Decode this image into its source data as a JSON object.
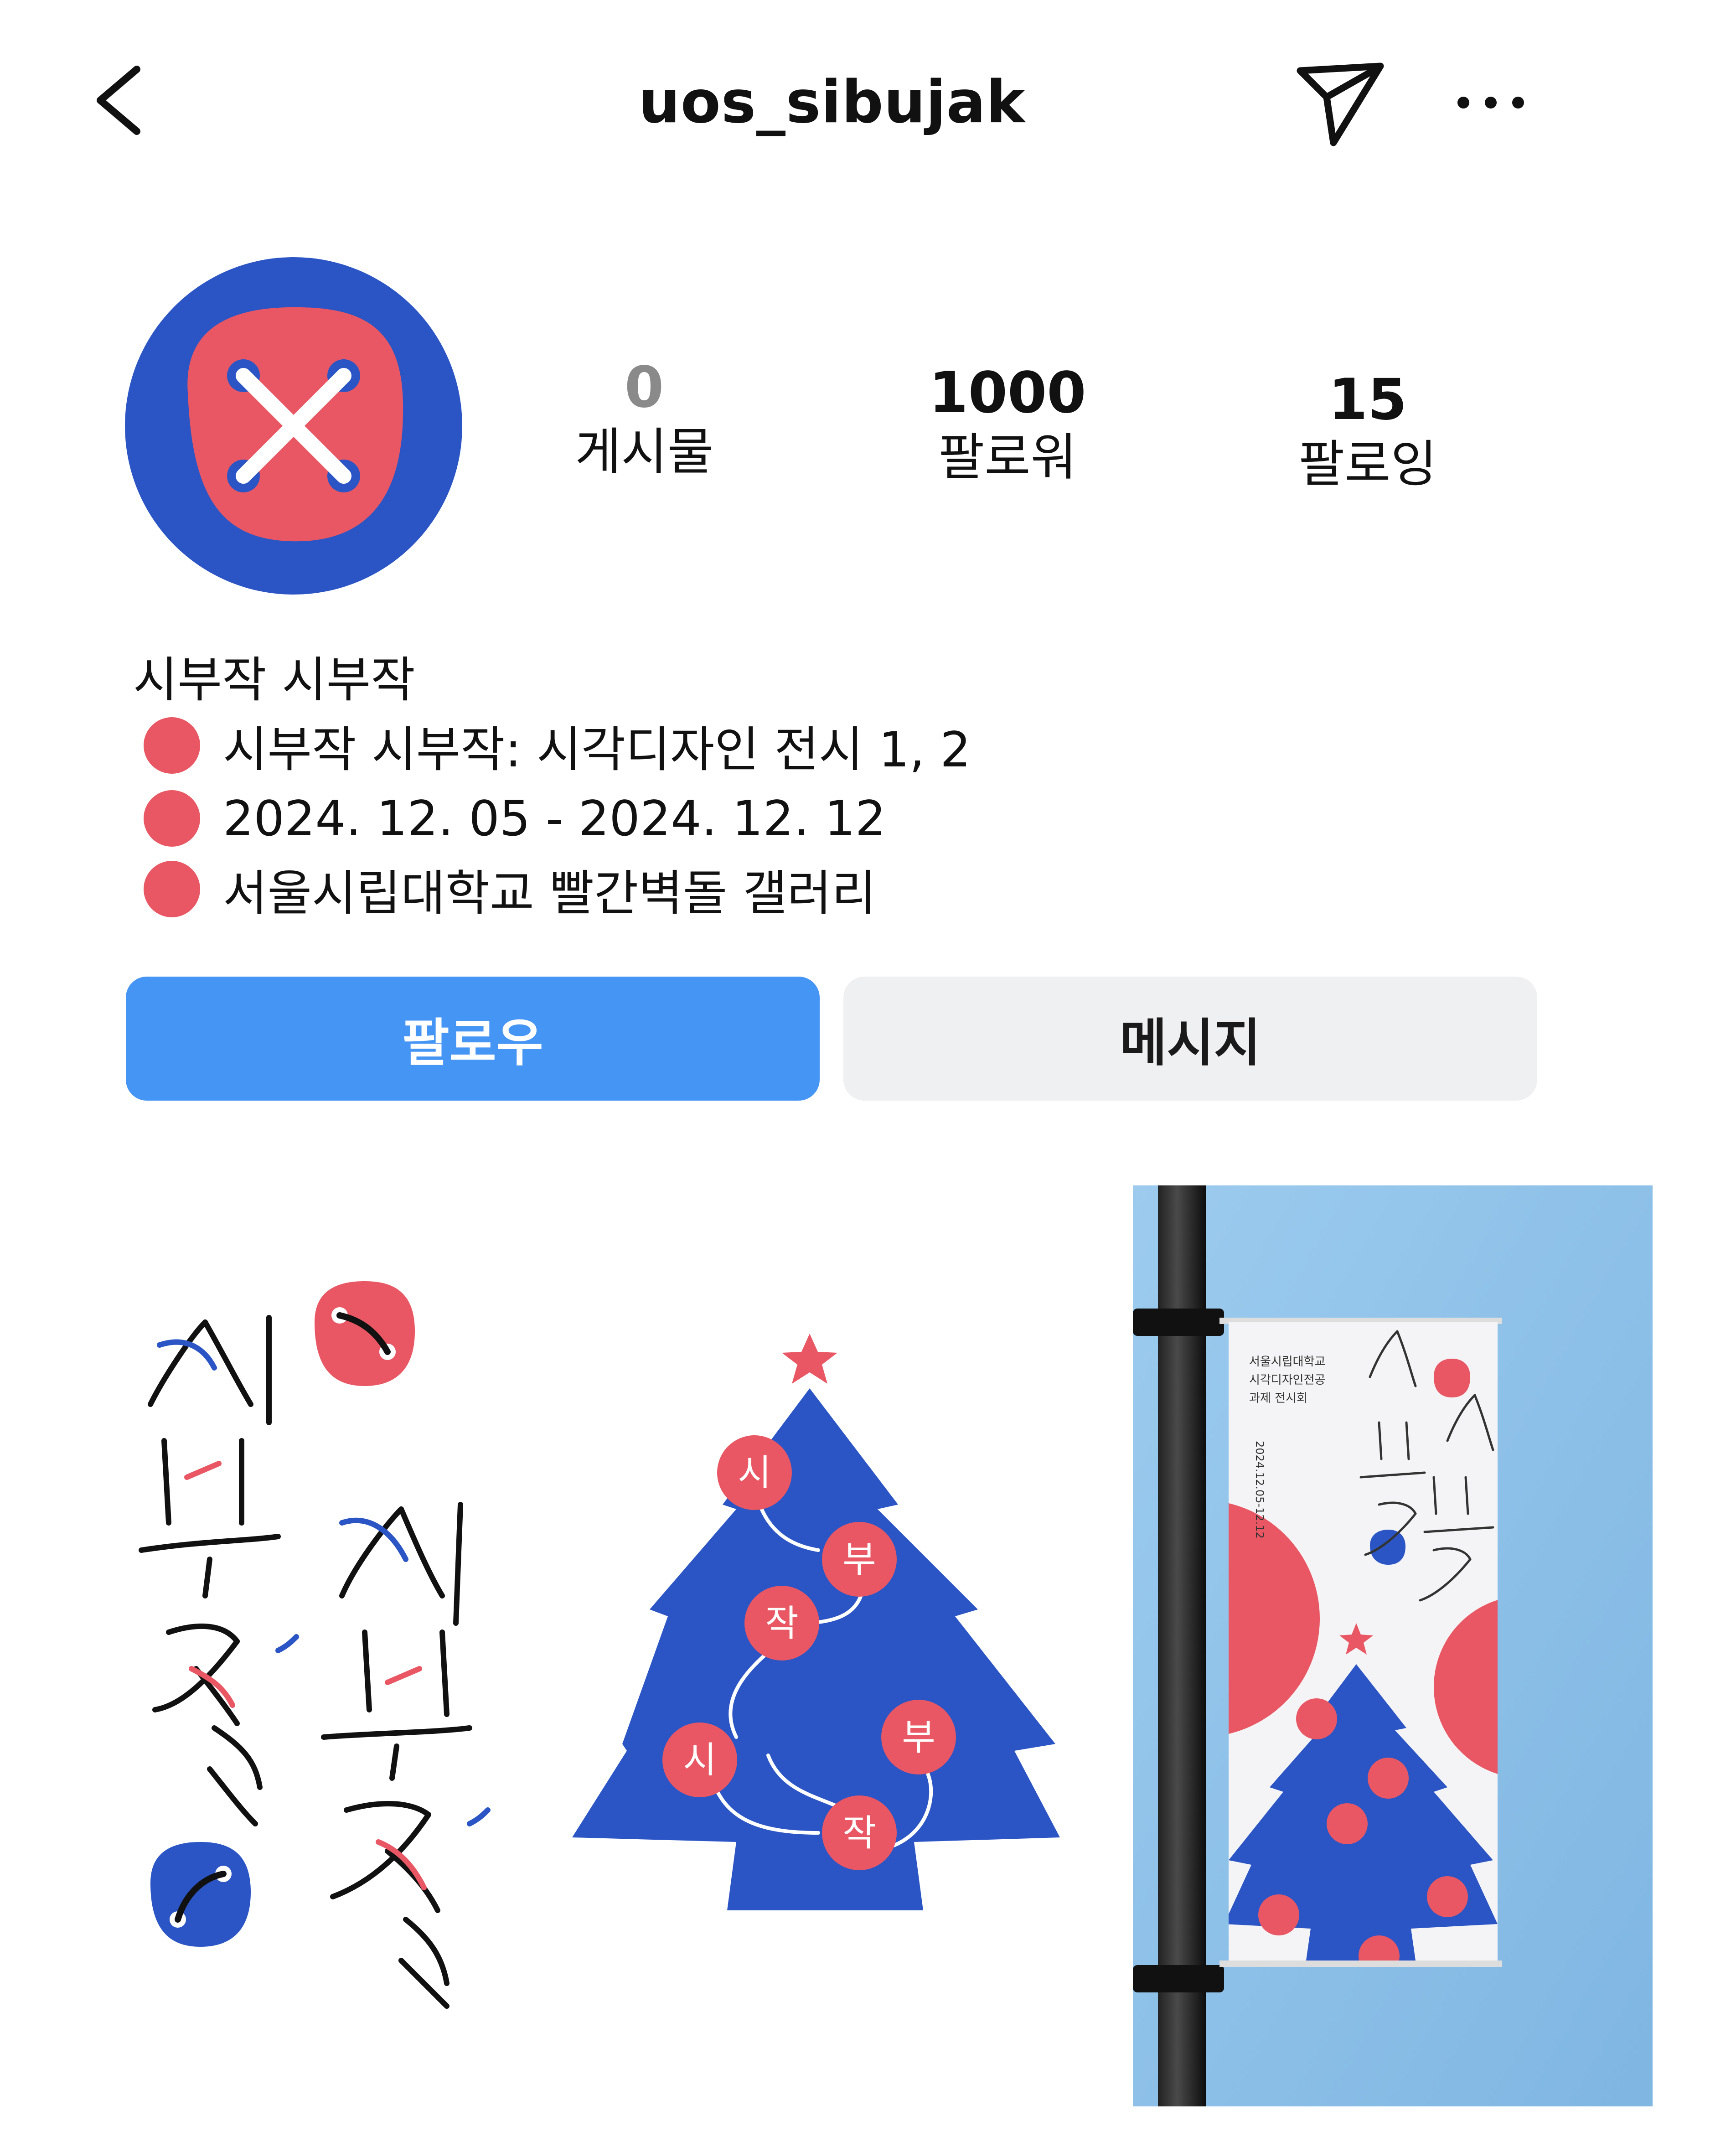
{
  "header": {
    "username": "uos_sibujak",
    "back_icon": "chevron-left-icon",
    "send_icon": "paper-plane-icon",
    "more_icon": "more-horizontal-icon"
  },
  "profile": {
    "avatar_icon": "button-logo-icon",
    "stats": [
      {
        "value": "0",
        "label": "게시물"
      },
      {
        "value": "1000",
        "label": "팔로워"
      },
      {
        "value": "15",
        "label": "팔로잉"
      }
    ]
  },
  "bio": {
    "name": "시부작 시부작",
    "lines": [
      "시부작 시부작: 시각디자인 전시 1, 2",
      "2024. 12. 05 - 2024. 12. 12",
      "서울시립대학교 빨간벽돌 갤러리"
    ]
  },
  "actions": {
    "follow": "팔로우",
    "message": "메시지"
  },
  "grid": {
    "banner_text": [
      "서울시립대학교",
      "시각디자인전공",
      "과제 전시회"
    ],
    "banner_date": "2024.12.05-12.12",
    "ornament_text": [
      "시",
      "부",
      "작",
      "부",
      "시",
      "작"
    ]
  },
  "colors": {
    "brand_blue": "#2b55c5",
    "brand_red": "#e85763",
    "follow_button": "#4595f4",
    "message_button": "#eff0f1",
    "sky": "#8fc2e8"
  }
}
